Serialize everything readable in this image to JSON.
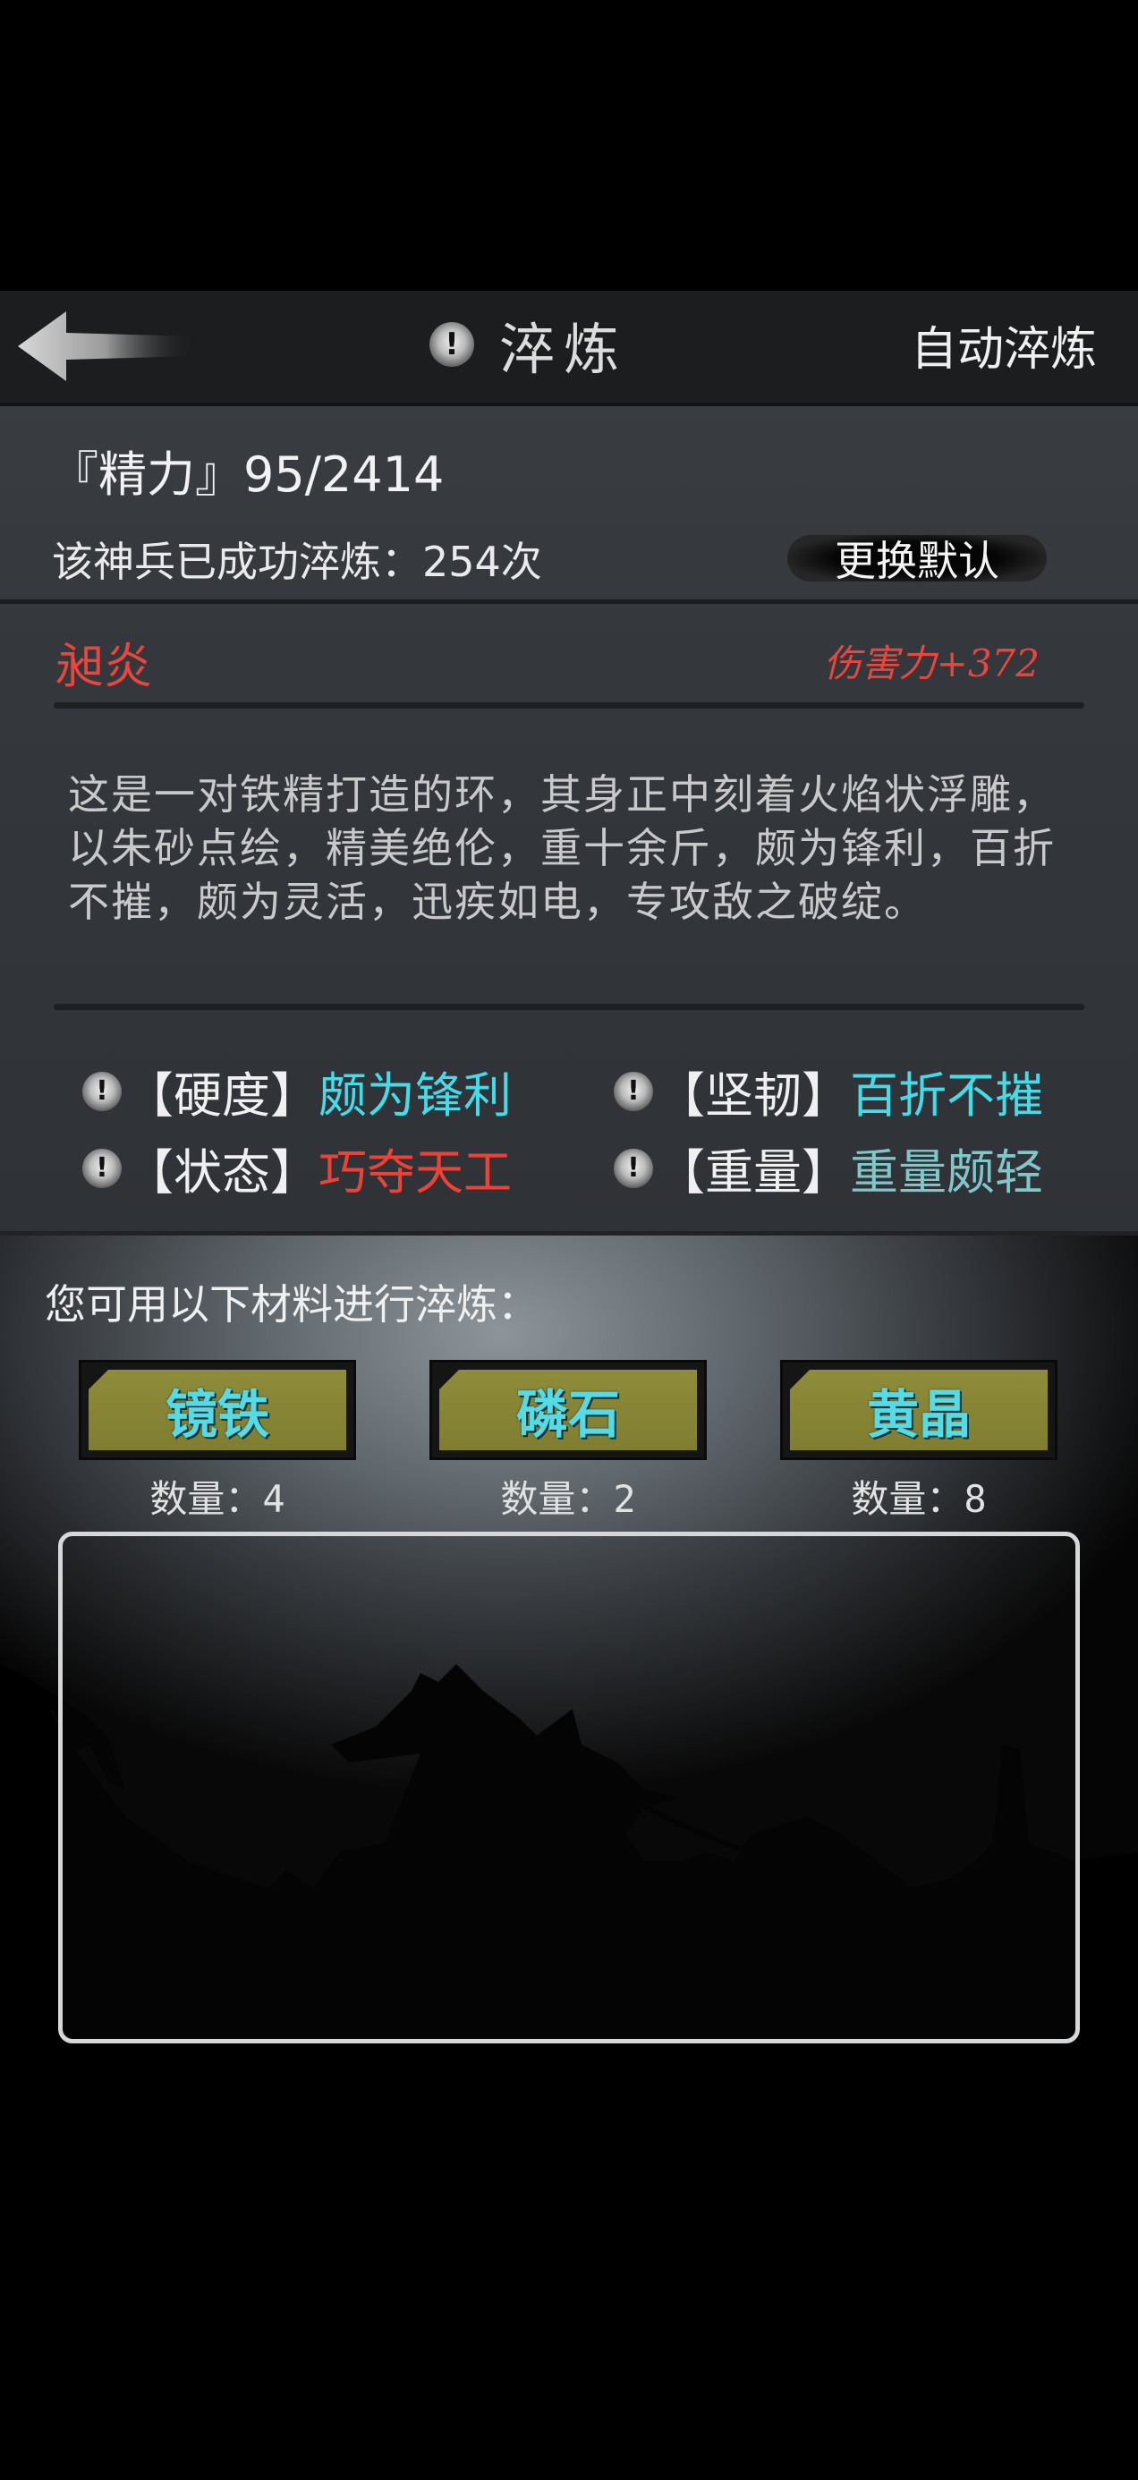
{
  "header": {
    "title": "淬炼",
    "auto_label": "自动淬炼",
    "info_icon": "!"
  },
  "status": {
    "energy": "『精力』95/2414",
    "refine_count": "该神兵已成功淬炼：254次",
    "change_default": "更换默认"
  },
  "weapon": {
    "name": "昶炎",
    "damage": "伤害力+372",
    "description": "这是一对铁精打造的环，其身正中刻着火焰状浮雕，以朱砂点绘，精美绝伦，重十余斤，颇为锋利，百折不摧，颇为灵活，迅疾如电，专攻敌之破绽。"
  },
  "attributes": [
    {
      "label": "【硬度】",
      "value": "颇为锋利",
      "color": "#45dbe8"
    },
    {
      "label": "【坚韧】",
      "value": "百折不摧",
      "color": "#45dbe8"
    },
    {
      "label": "【状态】",
      "value": "巧夺天工",
      "color": "#ef4236"
    },
    {
      "label": "【重量】",
      "value": "重量颇轻",
      "color": "#7fc7c9"
    }
  ],
  "materials": {
    "hint": "您可用以下材料进行淬炼：",
    "items": [
      {
        "name": "镜铁",
        "count_label": "数量：",
        "count": "4"
      },
      {
        "name": "磷石",
        "count_label": "数量：",
        "count": "2"
      },
      {
        "name": "黄晶",
        "count_label": "数量：",
        "count": "8"
      }
    ]
  },
  "icons": {
    "back": "back-arrow-icon",
    "info": "exclamation-icon"
  }
}
